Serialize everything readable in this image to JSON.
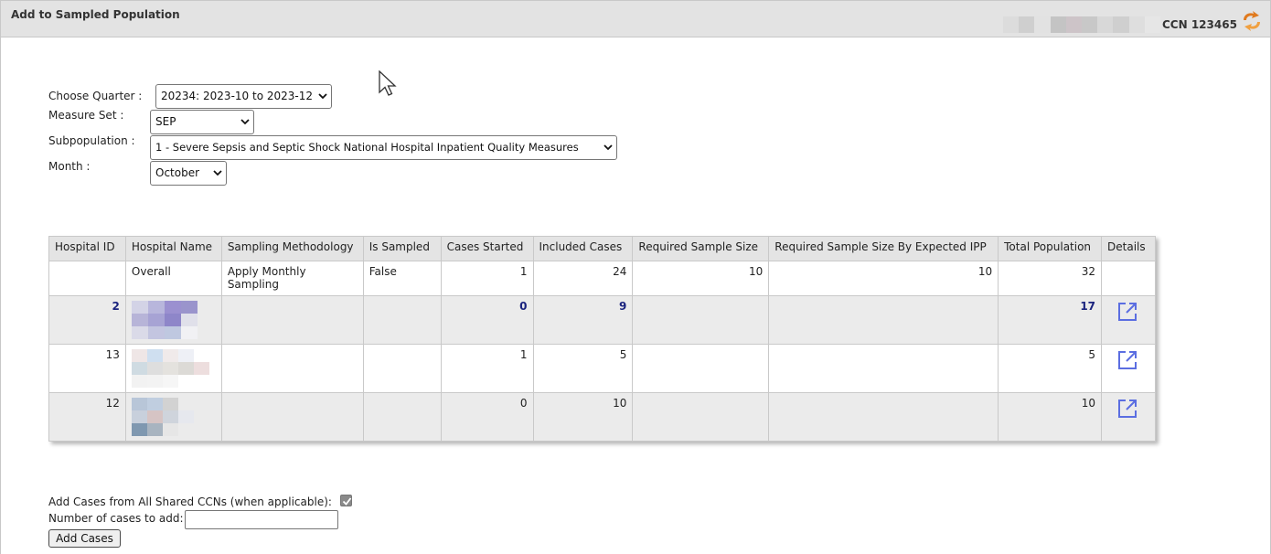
{
  "header": {
    "title": "Add to Sampled Population",
    "ccn": "CCN 123465"
  },
  "form": {
    "quarter_label": "Choose Quarter :",
    "quarter_value": "20234: 2023-10 to 2023-12",
    "measure_set_label": "Measure Set :",
    "measure_set_value": "SEP",
    "subpopulation_label": "Subpopulation :",
    "subpopulation_value": "1 - Severe Sepsis and Septic Shock National Hospital Inpatient Quality Measures",
    "month_label": "Month :",
    "month_value": "October"
  },
  "table": {
    "columns": [
      "Hospital ID",
      "Hospital Name",
      "Sampling Methodology",
      "Is Sampled",
      "Cases Started",
      "Included Cases",
      "Required Sample Size",
      "Required Sample Size By Expected IPP",
      "Total Population",
      "Details"
    ],
    "overall": {
      "hospital_id": "",
      "hospital_name": "Overall",
      "sampling_methodology": "Apply Monthly Sampling",
      "is_sampled": "False",
      "cases_started": "1",
      "included_cases": "24",
      "required_sample_size": "10",
      "required_sample_size_by_expected_ipp": "10",
      "total_population": "32"
    },
    "rows": [
      {
        "hospital_id": "2",
        "cases_started": "0",
        "included_cases": "9",
        "total_population": "17"
      },
      {
        "hospital_id": "13",
        "cases_started": "1",
        "included_cases": "5",
        "total_population": "5"
      },
      {
        "hospital_id": "12",
        "cases_started": "0",
        "included_cases": "10",
        "total_population": "10"
      }
    ]
  },
  "footer": {
    "share_label": "Add Cases from All Shared CCNs (when applicable):",
    "share_checked": true,
    "number_label": "Number of cases to add:",
    "number_value": "",
    "add_button": "Add Cases"
  },
  "colors": {
    "header_bg": "#e3e3e3",
    "table_header_bg": "#e4e4e4",
    "alt_row_bg": "#ebebeb",
    "link_blue": "#1a237e",
    "icon_blue": "#5b6ee1",
    "refresh_orange": "#e07a1e"
  },
  "icons": {
    "refresh": "refresh-icon",
    "details": "external-link-icon",
    "dropdown": "chevron-down-icon",
    "cursor": "mouse-cursor-icon"
  }
}
